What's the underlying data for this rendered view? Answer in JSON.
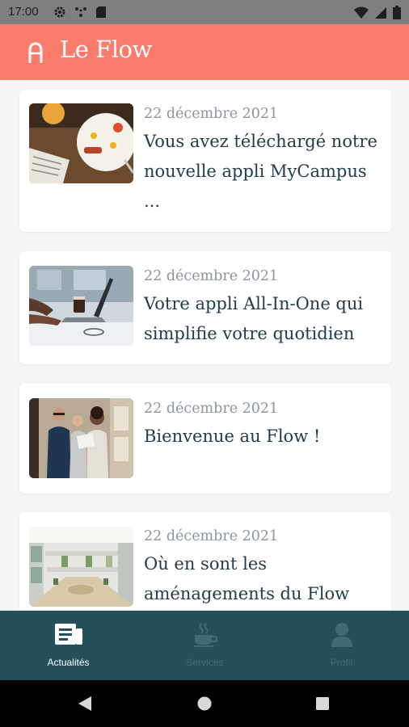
{
  "status_bar": {
    "time": "17:00"
  },
  "app_bar": {
    "title": "Le Flow"
  },
  "articles": [
    {
      "date": "22 décembre 2021",
      "title": "Vous avez téléchargé notre nouvelle appli MyCampus ..."
    },
    {
      "date": "22 décembre 2021",
      "title": "Votre appli All-In-One qui simplifie votre quotidien"
    },
    {
      "date": "22 décembre 2021",
      "title": "Bienvenue au Flow !"
    },
    {
      "date": "22 décembre 2021",
      "title": "Où en sont les aménagements du Flow"
    }
  ],
  "bottom_nav": {
    "items": [
      {
        "label": "Actualités",
        "icon": "news-icon",
        "active": true
      },
      {
        "label": "Services",
        "icon": "coffee-cup-icon",
        "active": false
      },
      {
        "label": "Profil",
        "icon": "person-icon",
        "active": false
      }
    ]
  },
  "colors": {
    "app_bar": "#fb7b6c",
    "bottom_nav": "#244f5b",
    "title_text": "#1f3c4a",
    "date_text": "#8a969d",
    "nav_active": "#ffffff",
    "nav_inactive": "#3f6a76"
  }
}
